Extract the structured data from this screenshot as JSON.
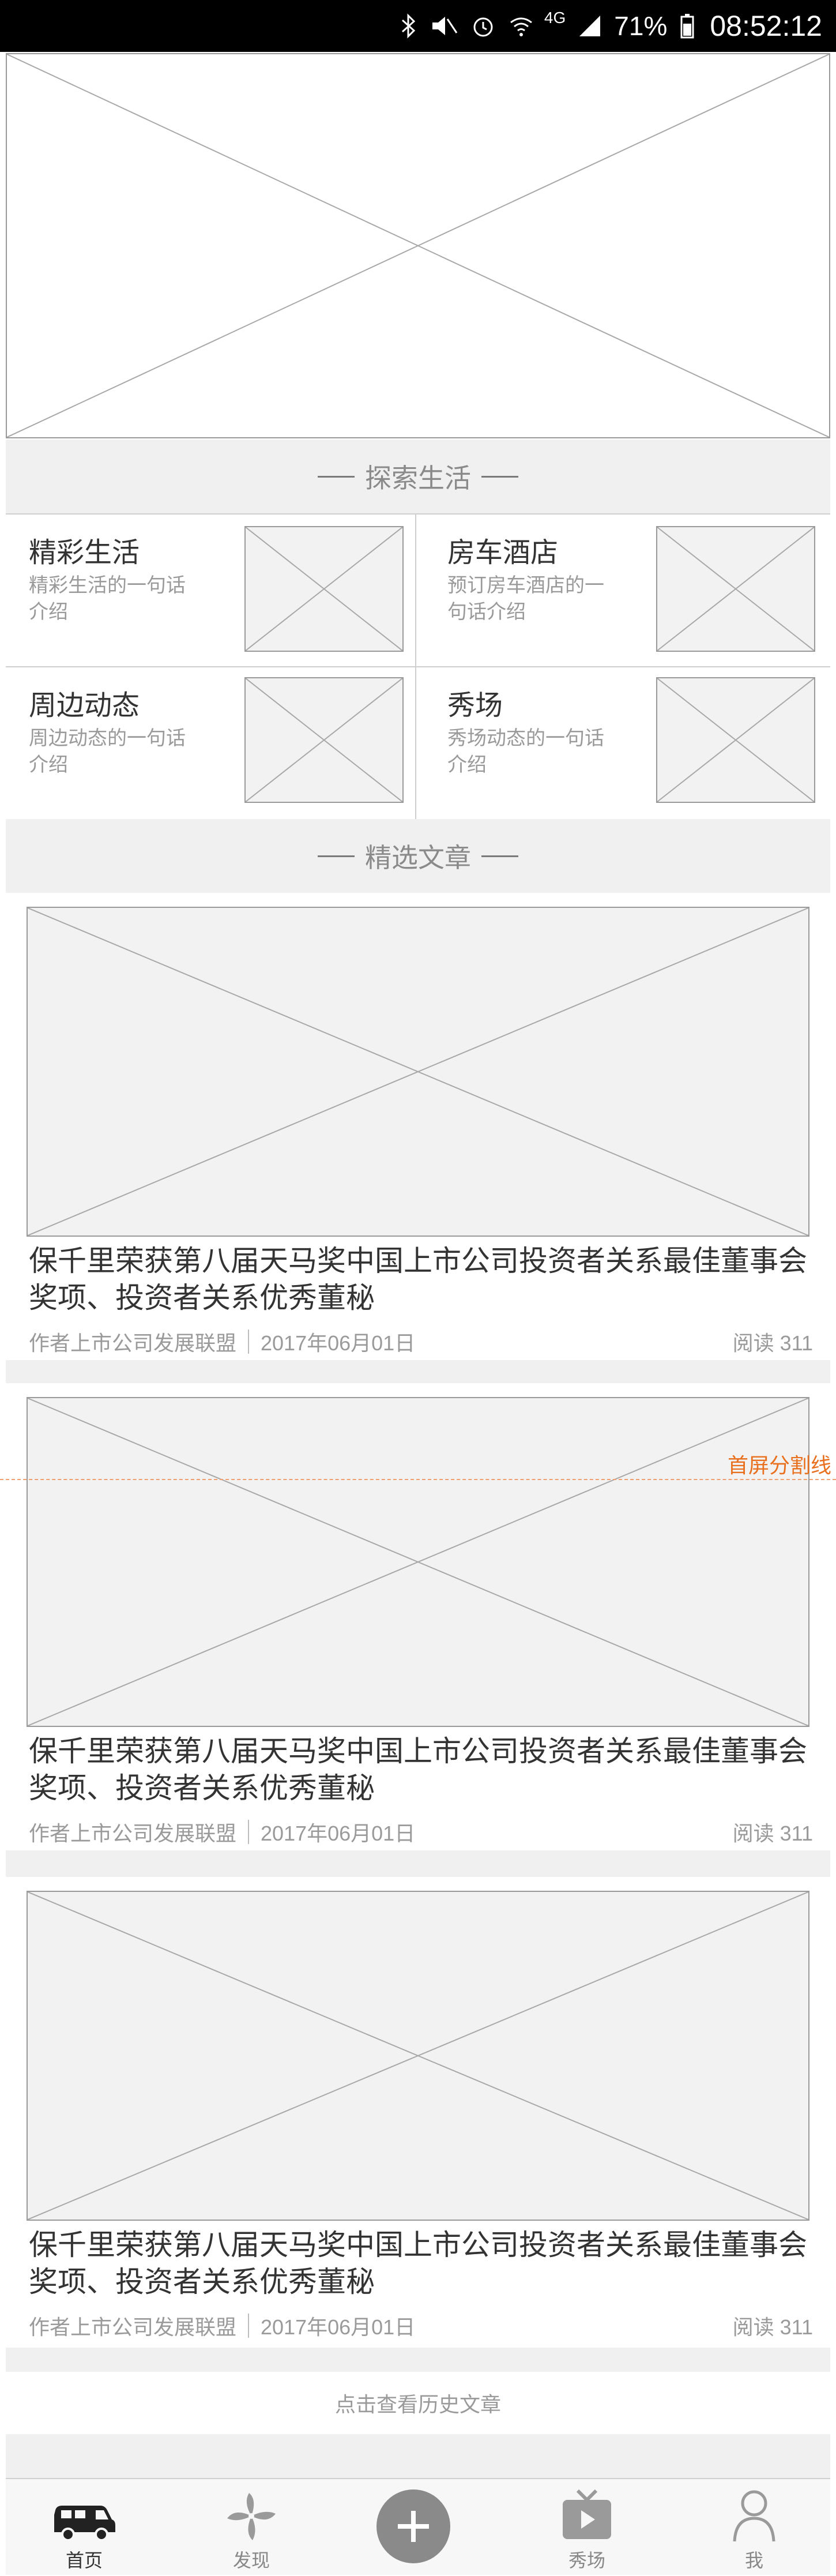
{
  "status_bar": {
    "network": "4G",
    "battery": "71%",
    "time": "08:52:12"
  },
  "sections": {
    "explore_title": "探索生活",
    "articles_title": "精选文章"
  },
  "categories": [
    {
      "title": "精彩生活",
      "desc": "精彩生活的一句话介绍"
    },
    {
      "title": "房车酒店",
      "desc": "预订房车酒店的一句话介绍"
    },
    {
      "title": "周边动态",
      "desc": "周边动态的一句话介绍"
    },
    {
      "title": "秀场",
      "desc": "秀场动态的一句话介绍"
    }
  ],
  "articles": [
    {
      "title": "保千里荣获第八届天马奖中国上市公司投资者关系最佳董事会奖项、投资者关系优秀董秘",
      "author": "作者上市公司发展联盟",
      "date": "2017年06月01日",
      "reads": "阅读 311"
    },
    {
      "title": "保千里荣获第八届天马奖中国上市公司投资者关系最佳董事会奖项、投资者关系优秀董秘",
      "author": "作者上市公司发展联盟",
      "date": "2017年06月01日",
      "reads": "阅读 311"
    },
    {
      "title": "保千里荣获第八届天马奖中国上市公司投资者关系最佳董事会奖项、投资者关系优秀董秘",
      "author": "作者上市公司发展联盟",
      "date": "2017年06月01日",
      "reads": "阅读 311"
    }
  ],
  "fold_label": "首屏分割线",
  "history_link": "点击查看历史文章",
  "tabs": [
    {
      "label": "首页",
      "icon": "rv-icon",
      "active": true
    },
    {
      "label": "发现",
      "icon": "pinwheel-icon",
      "active": false
    },
    {
      "label": "",
      "icon": "plus-icon",
      "active": false
    },
    {
      "label": "秀场",
      "icon": "tv-icon",
      "active": false
    },
    {
      "label": "我",
      "icon": "user-icon",
      "active": false
    }
  ]
}
